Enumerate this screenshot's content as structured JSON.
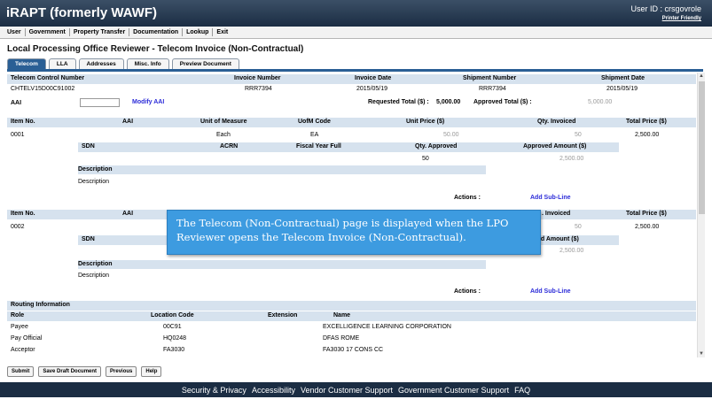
{
  "header": {
    "app_title": "iRAPT (formerly WAWF)",
    "user_id": "User ID : crsgovrole",
    "printer_friendly": "Printer Friendly"
  },
  "menu": [
    "User",
    "Government",
    "Property Transfer",
    "Documentation",
    "Lookup",
    "Exit"
  ],
  "page_title": "Local Processing Office Reviewer - Telecom Invoice (Non-Contractual)",
  "tabs": [
    "Telecom",
    "LLA",
    "Addresses",
    "Misc. Info",
    "Preview Document"
  ],
  "invoice": {
    "headers": [
      "Telecom Control Number",
      "Invoice Number",
      "Invoice Date",
      "Shipment Number",
      "Shipment Date"
    ],
    "values": [
      "CHTELV15D00C91002",
      "RRR7394",
      "2015/05/19",
      "RRR7394",
      "2015/05/19"
    ],
    "aai_label": "AAI",
    "modify_aai": "Modify AAI",
    "requested_total_label": "Requested Total ($) :",
    "requested_total": "5,000.00",
    "approved_total_label": "Approved Total ($) :",
    "approved_total": "5,000.00"
  },
  "line_headers": [
    "Item No.",
    "AAI",
    "Unit of Measure",
    "UofM Code",
    "Unit Price ($)",
    "Qty. Invoiced",
    "Total Price ($)"
  ],
  "sub_headers": [
    "SDN",
    "ACRN",
    "Fiscal Year Full",
    "Qty. Approved",
    "Approved Amount ($)"
  ],
  "lines": [
    {
      "item_no": "0001",
      "unit_of_measure": "Each",
      "uofm_code": "EA",
      "unit_price": "50.00",
      "qty_invoiced": "50",
      "total_price": "2,500.00",
      "qty_approved": "50",
      "approved_amount": "2,500.00",
      "description_label": "Description",
      "description": "Description",
      "actions_label": "Actions :",
      "add_sub_line": "Add Sub-Line"
    },
    {
      "item_no": "0002",
      "qty_invoiced": "50",
      "total_price": "2,500.00",
      "approved_amount": "2,500.00",
      "qty_invoiced_header": ". Invoiced",
      "approved_amount_header": "ed Amount ($)",
      "description_label": "Description",
      "description": "Description",
      "actions_label": "Actions :",
      "add_sub_line": "Add Sub-Line"
    }
  ],
  "routing": {
    "title": "Routing Information",
    "headers": [
      "Role",
      "Location Code",
      "Extension",
      "Name"
    ],
    "rows": [
      {
        "role": "Payee",
        "location": "00C91",
        "extension": "",
        "name": "EXCELLIGENCE LEARNING CORPORATION"
      },
      {
        "role": "Pay Official",
        "location": "HQ0248",
        "extension": "",
        "name": "DFAS ROME"
      },
      {
        "role": "Acceptor",
        "location": "FA3030",
        "extension": "",
        "name": "FA3030 17 CONS CC"
      }
    ]
  },
  "buttons": [
    "Submit",
    "Save Draft Document",
    "Previous",
    "Help"
  ],
  "footer": [
    "Security & Privacy",
    "Accessibility",
    "Vendor Customer Support",
    "Government Customer Support",
    "FAQ"
  ],
  "callout": "The Telecom (Non-Contractual) page is displayed when the LPO Reviewer opens the Telecom Invoice (Non-Contractual).",
  "colors": {
    "header": "#1b2d43",
    "tab_active": "#2a5f95",
    "row_header": "#d6e2ee",
    "link": "#2b2bd8",
    "callout": "#3d9be0"
  }
}
